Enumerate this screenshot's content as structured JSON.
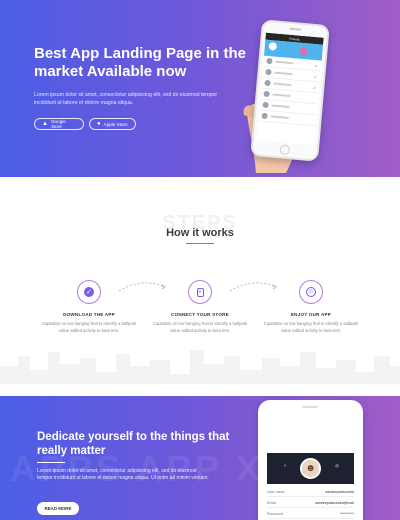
{
  "hero": {
    "title": "Best App Landing Page in the market Available now",
    "description": "Lorem ipsum dolor sit amet, consectetur adipisicing elit, sed do eiusmod tempor incididunt ut labore et dolore magna aliqua.",
    "buttons": [
      {
        "label": "Google Store",
        "icon": "android-icon"
      },
      {
        "label": "Apple Store",
        "icon": "apple-icon"
      }
    ],
    "phone": {
      "header": "Friends"
    }
  },
  "how_it_works": {
    "background_text": "STEPS",
    "title": "How it works",
    "accent": "#8b6ee8",
    "steps": [
      {
        "title": "DOWNLOAD THE APP",
        "description": "Capitalize on low hanging fruit to identify a ballpark value added activity to beta test.",
        "icon": "check-icon"
      },
      {
        "title": "CONNECT YOUR STORE",
        "description": "Capitalize on low hanging fruit to identify a ballpark value added activity to beta test.",
        "icon": "document-icon"
      },
      {
        "title": "ENJOY OUR APP",
        "description": "Capitalize on low hanging fruit to identify a ballpark value added activity to beta test.",
        "icon": "smile-icon"
      }
    ]
  },
  "dedicate": {
    "title": "Dedicate yourself to the things that really matter",
    "description": "Lorem ipsum dolor sit amet, consectetur adipisicing elit, sed do eiusmod tempor incididunt ut labore et dolore magna aliqua. Ut enim ad minim veniam.",
    "button": "READ MORE",
    "watermark": "APPS APP X",
    "profile": {
      "rows": [
        {
          "label": "User name",
          "value": "sandeepdasundra"
        },
        {
          "label": "Email",
          "value": "sandeepdasundra@mail"
        },
        {
          "label": "Password",
          "value": "**********"
        }
      ]
    }
  },
  "colors": {
    "gradient_start": "#4c5ee6",
    "gradient_end": "#a05dc6"
  }
}
